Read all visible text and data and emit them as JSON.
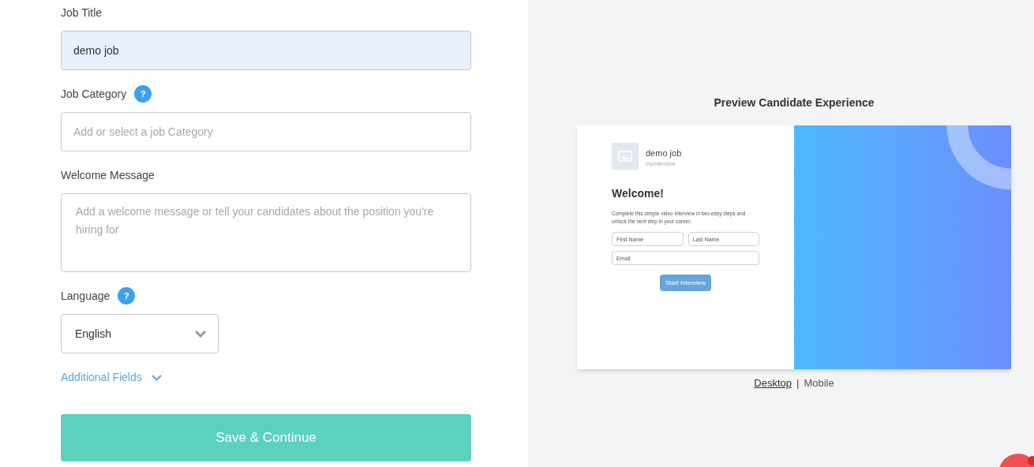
{
  "form": {
    "fields": [
      {
        "kind": "text",
        "label": "Job Title",
        "value": "demo job",
        "focused": true
      },
      {
        "kind": "select-input",
        "label": "Job Category",
        "help": "?",
        "placeholder": "Add or select a job Category",
        "focused": false
      },
      {
        "kind": "textarea",
        "label": "Welcome Message",
        "placeholder": "Add a welcome message or tell your candidates about the position you're hiring for",
        "focused": false
      },
      {
        "kind": "dropdown",
        "label": "Language",
        "help": "?",
        "value": "English",
        "focused": false
      }
    ],
    "additional_fields": {
      "label": "Additional Fields",
      "expanded": false
    },
    "submit": "Save & Continue"
  },
  "preview": {
    "title": "Preview Candidate Experience",
    "card": {
      "job": "demo job",
      "company": "myInterview",
      "heading": "Welcome!",
      "text": "Complete this simple video interview in two easy steps and unlock the next step in your career.",
      "inputs": [
        {
          "placeholder": "First Name"
        },
        {
          "placeholder": "Last Name"
        },
        {
          "placeholder": "Email"
        }
      ],
      "button": "Start Interview"
    },
    "modes": [
      {
        "label": "Desktop",
        "selected": true
      },
      {
        "label": "Mobile",
        "selected": false
      }
    ],
    "separator": "|"
  }
}
